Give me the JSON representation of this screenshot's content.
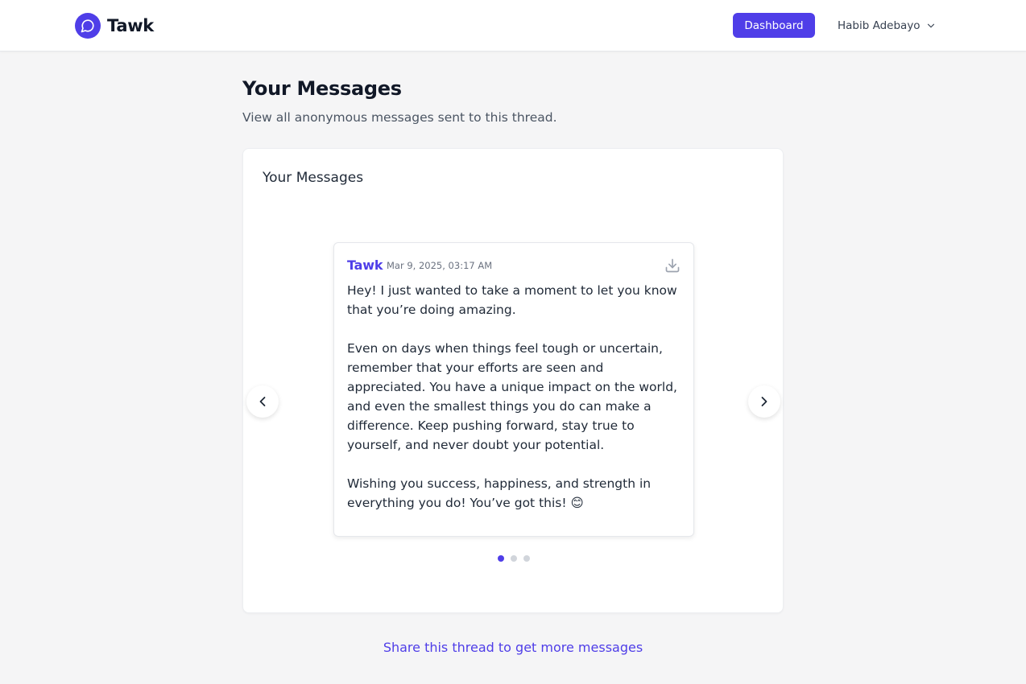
{
  "app": {
    "name": "Tawk",
    "brand_color": "#4f3ee8",
    "logo_icon": "chat-bubble-icon"
  },
  "header": {
    "dashboard_label": "Dashboard",
    "user_name": "Habib Adebayo",
    "user_menu_icon": "chevron-down-icon"
  },
  "page": {
    "title": "Your Messages",
    "subtitle": "View all anonymous messages sent to this thread."
  },
  "messages_card": {
    "title": "Your Messages",
    "carousel": {
      "current_index": 0,
      "total_slides": 3,
      "prev_icon": "chevron-left-icon",
      "next_icon": "chevron-right-icon"
    },
    "message": {
      "brand": "Tawk",
      "timestamp": "Mar 9, 2025, 03:17 AM",
      "download_icon": "download-icon",
      "paragraphs": [
        "Hey! I just wanted to take a moment to let you know that you’re doing amazing.",
        "Even on days when things feel tough or uncertain, remember that your efforts are seen and appreciated. You have a unique impact on the world, and even the smallest things you do can make a difference. Keep pushing forward, stay true to yourself, and never doubt your potential.",
        "Wishing you success, happiness, and strength in everything you do! You’ve got this! 😊"
      ]
    }
  },
  "footer": {
    "share_link": "Share this thread to get more messages"
  }
}
